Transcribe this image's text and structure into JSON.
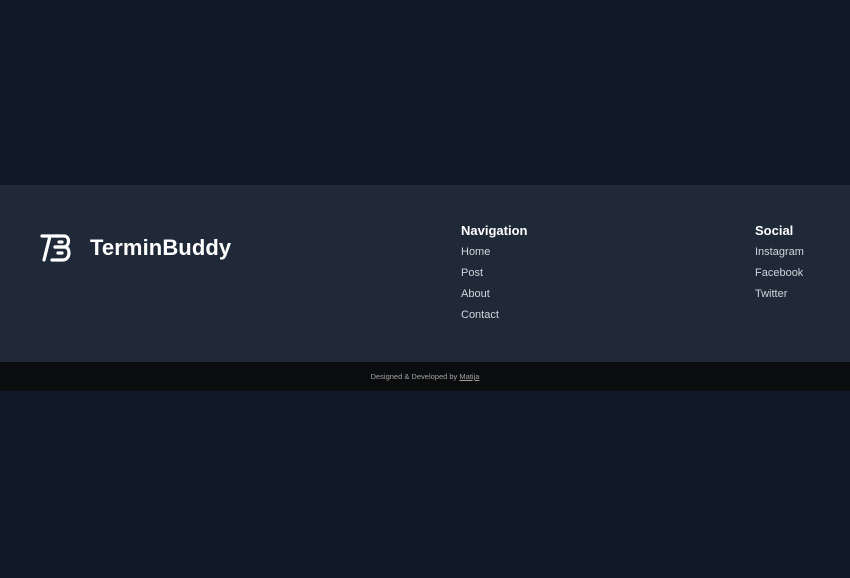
{
  "brand": {
    "name": "TerminBuddy"
  },
  "navigation": {
    "title": "Navigation",
    "links": [
      {
        "label": "Home"
      },
      {
        "label": "Post"
      },
      {
        "label": "About"
      },
      {
        "label": "Contact"
      }
    ]
  },
  "social": {
    "title": "Social",
    "links": [
      {
        "label": "Instagram"
      },
      {
        "label": "Facebook"
      },
      {
        "label": "Twitter"
      }
    ]
  },
  "credits": {
    "text": "Designed & Developed by",
    "author": "Matija"
  },
  "colors": {
    "page_background": "#111827",
    "footer_background": "#1f2937",
    "bottom_bar_background": "#0b0c0e",
    "heading": "#ffffff",
    "link": "#d1d5db"
  },
  "icons": {
    "brand_logo": "tb-monogram-icon"
  }
}
